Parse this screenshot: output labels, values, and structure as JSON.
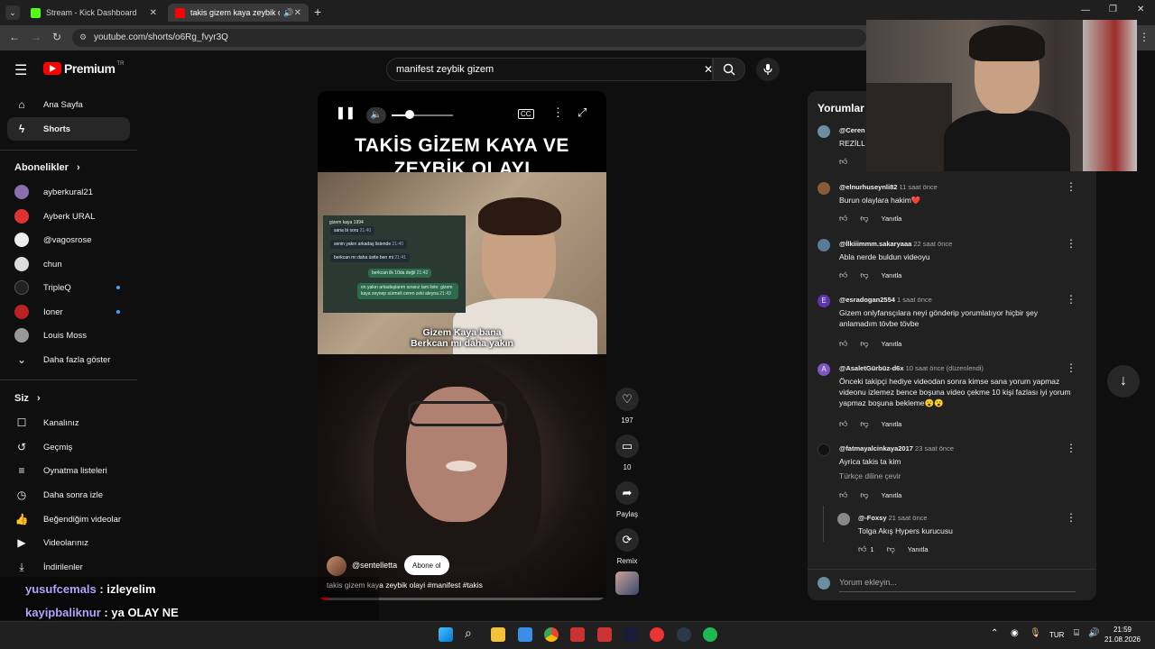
{
  "browser": {
    "tabs": [
      {
        "title": "Stream - Kick Dashboard",
        "color": "#53fc18"
      },
      {
        "title": "takis gizem kaya zeybik ola",
        "color": "#ff0000"
      }
    ],
    "new_tab": "+",
    "url": "youtube.com/shorts/o6Rg_fvyr3Q"
  },
  "youtube": {
    "logo_text": "Premium",
    "logo_badge": "TR",
    "search_value": "manifest zeybik gizem"
  },
  "sidebar": {
    "main": [
      {
        "label": "Ana Sayfa",
        "icon": "home-icon"
      },
      {
        "label": "Shorts",
        "icon": "shorts-icon"
      }
    ],
    "subs_title": "Abonelikler",
    "subs": [
      {
        "label": "ayberkural21",
        "color": "#8a6fb0",
        "live": false
      },
      {
        "label": "Ayberk URAL",
        "color": "#d33",
        "live": false
      },
      {
        "label": "@vagosrose",
        "color": "#eee",
        "live": false
      },
      {
        "label": "chun",
        "color": "#ddd",
        "live": false
      },
      {
        "label": "TripleQ",
        "color": "#222",
        "live": true
      },
      {
        "label": "Ioner",
        "color": "#b22",
        "live": true
      },
      {
        "label": "Louis Moss",
        "color": "#999",
        "live": false
      }
    ],
    "show_more": "Daha fazla göster",
    "you_title": "Siz",
    "you": [
      {
        "label": "Kanalınız",
        "icon": "channel-icon"
      },
      {
        "label": "Geçmiş",
        "icon": "history-icon"
      },
      {
        "label": "Oynatma listeleri",
        "icon": "playlists-icon"
      },
      {
        "label": "Daha sonra izle",
        "icon": "watch-later-icon"
      },
      {
        "label": "Beğendiğim videolar",
        "icon": "like-icon"
      },
      {
        "label": "Videolarınız",
        "icon": "videos-icon"
      },
      {
        "label": "İndirilenler",
        "icon": "download-icon"
      }
    ]
  },
  "short": {
    "title_line1": "TAKİS GİZEM KAYA VE",
    "title_line2": "ZEYBİK OLAYI",
    "chat_header": "gizem kaya 1994",
    "chat_lines": [
      {
        "text": "sana bi soru",
        "time": "21:40",
        "me": false
      },
      {
        "text": "senin yakın arkadaş listende",
        "time": "21:40",
        "me": false
      },
      {
        "text": "berkcan mı daha üstte ben mi",
        "time": "21:41",
        "me": false
      },
      {
        "text": "berkcan ilk 10da değil",
        "time": "21:42",
        "me": true
      },
      {
        "text": "en yakın arkadaşlarım sırasız tam liste: gizem kaya zeynep sürmeli ceren zeki aleyna",
        "time": "21:43",
        "me": true
      }
    ],
    "caption_line1": "Gizem Kaya bana",
    "caption_line2": "Berkcan mı daha yakın",
    "channel": "@sentelletta",
    "subscribe": "Abone ol",
    "description": "takis gizem kaya zeybik olayi #manifest #takis",
    "volume_fraction": 0.3,
    "progress_fraction": 0.04
  },
  "actions": {
    "likes": "197",
    "comments": "10",
    "share": "Paylaş",
    "remix": "Remix"
  },
  "comments": {
    "title": "Yorumlar",
    "reply_label": "Yanıtla",
    "input_placeholder": "Yorum ekleyin...",
    "items": [
      {
        "user": "@Ceren",
        "time": "",
        "text": "REZİLL",
        "color": "#6a8fa0",
        "likes": "",
        "reply": false
      },
      {
        "user": "@elnurhuseynli82",
        "time": "11 saat önce",
        "text": "Burun olaylara hakim❤️",
        "color": "#8a5a3a",
        "likes": "",
        "reply": false
      },
      {
        "user": "@İlkiiimmm.sakaryaaa",
        "time": "22 saat önce",
        "text": "Abla nerde buldun videoyu",
        "color": "#5a7a9a",
        "likes": "",
        "reply": false
      },
      {
        "user": "@esradogan2554",
        "time": "1 saat önce",
        "text": "Gizem onlyfansçılara neyi gönderip yorumlatıyor hiçbir şey anlamadım tövbe tövbe",
        "color": "#5e35b1",
        "letter": "E",
        "likes": "",
        "reply": false
      },
      {
        "user": "@AsaletGürbüz-d6x",
        "time": "10 saat önce (düzenlendi)",
        "text": "Önceki takipçi  hediye videodan sonra kimse sana yorum yapmaz videonu izlemez bence boşuna video çekme 10 kişi fazlası iyi yorum yapmaz boşuna bekleme😮😮",
        "color": "#7e57c2",
        "letter": "A",
        "likes": "",
        "reply": false
      },
      {
        "user": "@fatmayalcinkaya2017",
        "time": "23 saat önce",
        "text": "Ayrica takis ta kim",
        "translate": "Türkçe diline çevir",
        "color": "#111",
        "likes": "",
        "reply": false
      },
      {
        "user": "@-Foxsy",
        "time": "21 saat önce",
        "text": "Tolga Akış Hypers kurucusu",
        "color": "#888",
        "likes": "1",
        "reply": true
      }
    ]
  },
  "stream_chat": [
    {
      "user": "yusufcemals",
      "message": "izleyelim"
    },
    {
      "user": "kayipbaliknur",
      "message": "ya OLAY NE"
    }
  ],
  "taskbar": {
    "lang": "TUR",
    "time": "21:59",
    "date": "21.08.2026"
  }
}
